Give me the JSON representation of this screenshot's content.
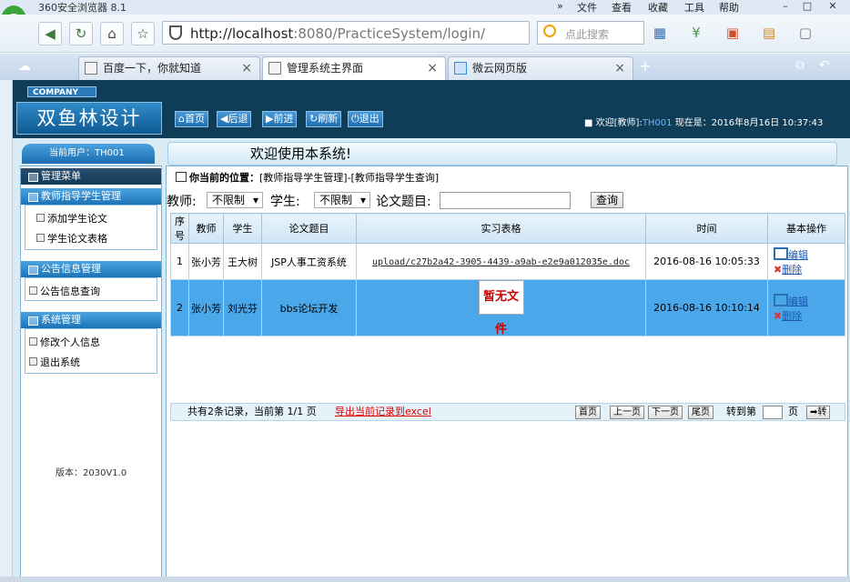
{
  "browser": {
    "title": "360安全浏览器 8.1",
    "menu": [
      "文件",
      "查看",
      "收藏",
      "工具",
      "帮助"
    ],
    "address_host": "http://localhost",
    "address_rest": ":8080/PracticeSystem/login/",
    "search_placeholder": "点此搜索",
    "tabs": [
      {
        "label": "百度一下，你就知道",
        "active": false
      },
      {
        "label": "管理系统主界面",
        "active": true
      },
      {
        "label": "微云网页版",
        "active": false
      }
    ]
  },
  "app": {
    "company": "COMPANY",
    "logo": "双鱼林设计",
    "toolbar": [
      "首页",
      "后退",
      "前进",
      "刷新",
      "退出"
    ],
    "welcome_prefix": "欢迎[教师]:",
    "welcome_user": "TH001",
    "now_label": "现在是：2016年8月16日 10:37:43",
    "current_user": "当前用户：TH001",
    "banner": "欢迎使用本系统!",
    "sidebar": {
      "main_menu": "管理菜单",
      "group1": "教师指导学生管理",
      "group1_items": [
        "添加学生论文",
        "学生论文表格"
      ],
      "group2": "公告信息管理",
      "group2_items": [
        "公告信息查询"
      ],
      "group3": "系统管理",
      "group3_items": [
        "修改个人信息",
        "退出系统"
      ],
      "version": "版本：2030V1.0"
    },
    "position_label": "你当前的位置：",
    "position_path": "[教师指导学生管理]-[教师指导学生查询]",
    "filter": {
      "teacher_label": "教师:",
      "teacher_value": "不限制",
      "student_label": "学生:",
      "student_value": "不限制",
      "title_label": "论文题目:",
      "query_button": "查询"
    },
    "table": {
      "headers": [
        "序号",
        "教师",
        "学生",
        "论文题目",
        "实习表格",
        "时间",
        "基本操作"
      ],
      "rows": [
        {
          "no": "1",
          "teacher": "张小芳",
          "student": "王大树",
          "title": "JSP人事工资系统",
          "file": "upload/c27b2a42-3905-4439-a9ab-e2e9a012035e.doc",
          "time": "2016-08-16 10:05:33",
          "edit": "编辑",
          "del": "删除"
        },
        {
          "no": "2",
          "teacher": "张小芳",
          "student": "刘光芬",
          "title": "bbs论坛开发",
          "file": "暂无文件",
          "time": "2016-08-16 10:10:14",
          "edit": "编辑",
          "del": "删除"
        }
      ]
    },
    "footer": {
      "info": "共有2条记录，当前第 1/1 页",
      "export": "导出当前记录到excel",
      "first": "首页",
      "prev": "上一页",
      "next": "下一页",
      "last": "尾页",
      "goto": "转到第",
      "page_unit": "页",
      "go": "➡转"
    }
  }
}
